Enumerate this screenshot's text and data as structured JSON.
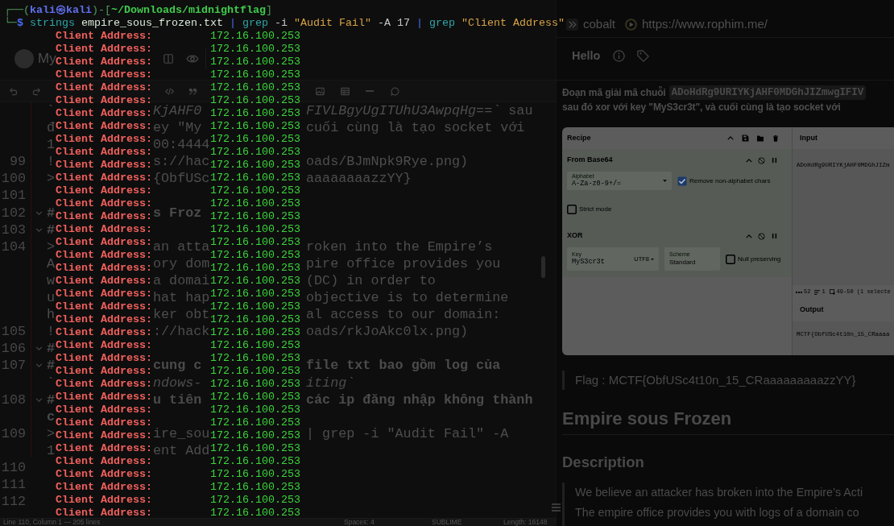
{
  "terminal": {
    "prompt": [
      {
        "text": "┌──(",
        "kind": "frame"
      },
      {
        "text": "kali㉿kali",
        "kind": "user"
      },
      {
        "text": ")-[",
        "kind": "frame"
      },
      {
        "text": "~/Downloads/midnightflag",
        "kind": "path"
      },
      {
        "text": "]",
        "kind": "frame"
      }
    ],
    "command": [
      {
        "text": "└─",
        "kind": "frame"
      },
      {
        "text": "$",
        "kind": "symbol"
      },
      {
        "text": " strings",
        "kind": "command"
      },
      {
        "text": " empire_sous_frozen.txt",
        "kind": "argument"
      },
      {
        "text": " |",
        "kind": "pipe"
      },
      {
        "text": " grep",
        "kind": "command"
      },
      {
        "text": " -i",
        "kind": "option"
      },
      {
        "text": " \"Audit Fail\"",
        "kind": "string"
      },
      {
        "text": " -A 17",
        "kind": "option"
      },
      {
        "text": " |",
        "kind": "pipe"
      },
      {
        "text": " grep",
        "kind": "command"
      },
      {
        "text": " \"Client Address\"",
        "kind": "string"
      }
    ],
    "output": [
      {
        "label": "Client Address:",
        "value": "172.16.100.253"
      },
      {
        "label": "Client Address:",
        "value": "172.16.100.253"
      },
      {
        "label": "Client Address:",
        "value": "172.16.100.253"
      },
      {
        "label": "Client Address:",
        "value": "172.16.100.253"
      },
      {
        "label": "Client Address:",
        "value": "172.16.100.253"
      },
      {
        "label": "Client Address:",
        "value": "172.16.100.253"
      },
      {
        "label": "Client Address:",
        "value": "172.16.100.253"
      },
      {
        "label": "Client Address:",
        "value": "172.16.100.253"
      },
      {
        "label": "Client Address:",
        "value": "172.16.100.253"
      },
      {
        "label": "Client Address:",
        "value": "172.16.100.253"
      },
      {
        "label": "Client Address:",
        "value": "172.16.100.253"
      },
      {
        "label": "Client Address:",
        "value": "172.16.100.253"
      },
      {
        "label": "Client Address:",
        "value": "172.16.100.253"
      },
      {
        "label": "Client Address:",
        "value": "172.16.100.253"
      },
      {
        "label": "Client Address:",
        "value": "172.16.100.253"
      },
      {
        "label": "Client Address:",
        "value": "172.16.100.253"
      },
      {
        "label": "Client Address:",
        "value": "172.16.100.253"
      },
      {
        "label": "Client Address:",
        "value": "172.16.100.253"
      },
      {
        "label": "Client Address:",
        "value": "172.16.100.253"
      },
      {
        "label": "Client Address:",
        "value": "172.16.100.253"
      },
      {
        "label": "Client Address:",
        "value": "172.16.100.253"
      },
      {
        "label": "Client Address:",
        "value": "172.16.100.253"
      },
      {
        "label": "Client Address:",
        "value": "172.16.100.253"
      },
      {
        "label": "Client Address:",
        "value": "172.16.100.253"
      },
      {
        "label": "Client Address:",
        "value": "172.16.100.253"
      },
      {
        "label": "Client Address:",
        "value": "172.16.100.253"
      },
      {
        "label": "Client Address:",
        "value": "172.16.100.253"
      },
      {
        "label": "Client Address:",
        "value": "172.16.100.253"
      },
      {
        "label": "Client Address:",
        "value": "172.16.100.253"
      },
      {
        "label": "Client Address:",
        "value": "172.16.100.253"
      },
      {
        "label": "Client Address:",
        "value": "172.16.100.253"
      },
      {
        "label": "Client Address:",
        "value": "172.16.100.253"
      },
      {
        "label": "Client Address:",
        "value": "172.16.100.253"
      },
      {
        "label": "Client Address:",
        "value": "172.16.100.253"
      },
      {
        "label": "Client Address:",
        "value": "172.16.100.253"
      },
      {
        "label": "Client Address:",
        "value": "172.16.100.253"
      },
      {
        "label": "Client Address:",
        "value": "172.16.100.253"
      },
      {
        "label": "Client Address:",
        "value": "172.16.100.253"
      }
    ]
  },
  "editor": {
    "workspace": "My",
    "rows": [
      {
        "fold": false,
        "lead": "`",
        "mid": "*KjAHF0*",
        "tail": "*FIVLBgyUgITUhU3AwpqHg==`* sau",
        "kind": "text"
      },
      {
        "fold": false,
        "lead": "đ",
        "mid": "ey \"My",
        "tail": "cuối cùng là tạo socket với",
        "kind": "text"
      },
      {
        "fold": false,
        "lead": "1",
        "mid": "00:4444",
        "kind": "text"
      },
      {
        "number": "99",
        "fold": false,
        "lead": "!",
        "mid": "s://hac",
        "tail": "oads/BJmNpk9Rye.png)",
        "kind": "text"
      },
      {
        "number": "100",
        "fold": false,
        "lead": ">",
        "mid": "{ObfUSc",
        "tail": "aaaaaaaazzYY}",
        "kind": "text"
      },
      {
        "number": "101",
        "fold": false
      },
      {
        "number": "102",
        "fold": true,
        "lead": "#",
        "mid": "s Froz",
        "kind": "heading"
      },
      {
        "number": "103",
        "fold": true,
        "lead": "#",
        "kind": "heading"
      },
      {
        "number": "104",
        "fold": false,
        "lead": ">",
        "mid": "an atta",
        "tail": "roken into the Empire’s",
        "kind": "text"
      },
      {
        "fold": false,
        "lead": "A",
        "mid": "ory dom",
        "tail": "pire office provides you",
        "kind": "text"
      },
      {
        "fold": false,
        "lead": "w",
        "mid": "a domai",
        "tail": "(DC) in order to",
        "kind": "text"
      },
      {
        "fold": false,
        "lead": "u",
        "mid": "hat hap",
        "tail": "objective is to determine",
        "kind": "text"
      },
      {
        "fold": false,
        "lead": "h",
        "mid": "ker obt",
        "tail": "al access to our domain:",
        "kind": "text"
      },
      {
        "number": "105",
        "fold": false,
        "lead": "!",
        "mid": "://hack",
        "tail": "oads/rkJoAkc0lx.png)",
        "kind": "text"
      },
      {
        "number": "106",
        "fold": true,
        "lead": "#",
        "kind": "heading"
      },
      {
        "number": "107",
        "fold": true,
        "lead": "#",
        "mid": "cung c",
        "tail": "file txt bao gồm log của",
        "kind": "heading"
      },
      {
        "fold": false,
        "lead": "`",
        "mid": "*ndows-*",
        "tail": "*iting`*",
        "kind": "text"
      },
      {
        "number": "108",
        "fold": true,
        "lead": "#",
        "mid": "u tiên",
        "tail": "các ip đăng nhập không thành",
        "kind": "heading"
      },
      {
        "fold": false,
        "lead": "c",
        "kind": "heading"
      },
      {
        "number": "109",
        "fold": false,
        "lead": ">",
        "mid": "ire_sou",
        "tail": "| grep -i \"Audit Fail\" -A",
        "kind": "text"
      },
      {
        "fold": false,
        "lead": "1",
        "mid": "ent Add",
        "kind": "text"
      },
      {
        "number": "110",
        "fold": false
      },
      {
        "number": "111",
        "fold": false
      },
      {
        "number": "112",
        "fold": false
      }
    ],
    "status_bar": [
      "Line 110, Column 1 — 205 lines",
      "Spaces: 4",
      "SUBLIME",
      "Length: 16148"
    ]
  },
  "browser": {
    "bookmarks": [
      {
        "label": "cobalt"
      },
      {
        "label": "https://www.rophim.me/"
      }
    ]
  },
  "note": {
    "title": "Hello",
    "intro": [
      [
        {
          "text": "Đoạn mã giải mã chuỗi",
          "kind": "text"
        },
        {
          "text": "ADoHdRg9URIYKjAHF0MDGhJIZmwgIFIV",
          "kind": "code"
        }
      ],
      [
        {
          "text": "sau đó xor với key \"MyS3cr3t\", và cuối cùng là tạo socket với",
          "kind": "text"
        }
      ]
    ],
    "cyberchef": {
      "recipe_title": "Recipe",
      "operations": [
        {
          "name": "From Base64",
          "fields": [
            {
              "label": "Alphabet",
              "value": "A-Za-z0-9+/=",
              "kind": "dropdown"
            }
          ],
          "options": [
            {
              "label": "Remove non-alphabet chars",
              "checked": true
            },
            {
              "label": "Strict mode",
              "checked": false
            }
          ]
        },
        {
          "name": "XOR",
          "fields": [
            {
              "label": "Key",
              "value": "MyS3cr3t",
              "unit": "UTF8",
              "kind": "key"
            },
            {
              "label": "Scheme",
              "value": "Standard",
              "kind": "select"
            }
          ],
          "options": [
            {
              "label": "Null preserving",
              "checked": false
            }
          ]
        }
      ],
      "input_title": "Input",
      "input": "ADoHdRg9URIYKjAHF0MDGhJIZm",
      "stats": [
        {
          "value": "52"
        },
        {
          "value": "1"
        },
        {
          "value": "49-50 (1 selecte"
        }
      ],
      "output_title": "Output",
      "output": "MCTF{ObfUSc4t10n_15_CRaaaa"
    },
    "flag": "Flag : MCTF{ObfUSc4t10n_15_CRaaaaaaaaazzYY}",
    "heading": "Empire sous Frozen",
    "subheading": "Description",
    "quote": [
      "We believe an attacker has broken into the Empire’s Acti",
      "The empire office provides you with logs of a domain co"
    ]
  }
}
